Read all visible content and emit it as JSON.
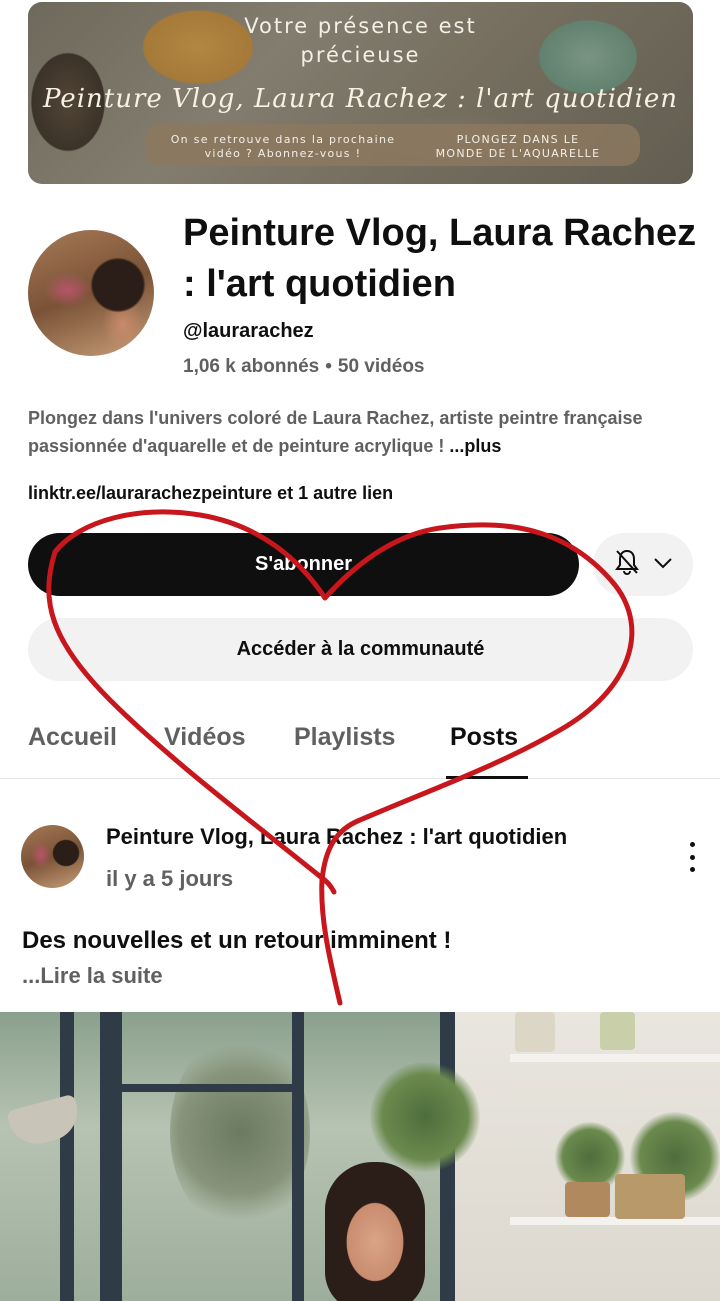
{
  "banner": {
    "title_line1": "Votre présence est",
    "title_line2": "précieuse",
    "script": "Peinture Vlog, Laura Rachez : l'art quotidien",
    "left_line1": "On se retrouve dans la prochaine",
    "left_line2": "vidéo ? Abonnez-vous !",
    "right_line1": "PLONGEZ DANS LE",
    "right_line2": "MONDE DE L'AQUARELLE"
  },
  "channel": {
    "title": "Peinture Vlog, Laura Rachez : l'art quotidien",
    "handle": "@laurarachez",
    "subscribers": "1,06 k abonnés",
    "separator": "•",
    "videos": "50 vidéos",
    "description": "Plongez dans l'univers coloré de Laura Rachez, artiste peintre française passionnée d'aquarelle et de peinture acrylique ! ",
    "description_more": "...plus",
    "links": "linktr.ee/laurarachezpeinture et 1 autre lien"
  },
  "buttons": {
    "subscribe": "S'abonner",
    "community": "Accéder à la communauté"
  },
  "tabs": [
    {
      "label": "Accueil"
    },
    {
      "label": "Vidéos"
    },
    {
      "label": "Playlists"
    },
    {
      "label": "Posts"
    }
  ],
  "post": {
    "author": "Peinture Vlog, Laura Rachez : l'art quotidien",
    "time": "il y a 5 jours",
    "title": "Des nouvelles et un retour imminent !",
    "read_more": "...Lire la suite"
  },
  "colors": {
    "annotation": "#c8161d",
    "subscribe_bg": "#0f0f0f",
    "secondary_text": "#606060"
  },
  "icons": [
    "bell-off-icon",
    "chevron-down-icon",
    "more-vert-icon"
  ]
}
